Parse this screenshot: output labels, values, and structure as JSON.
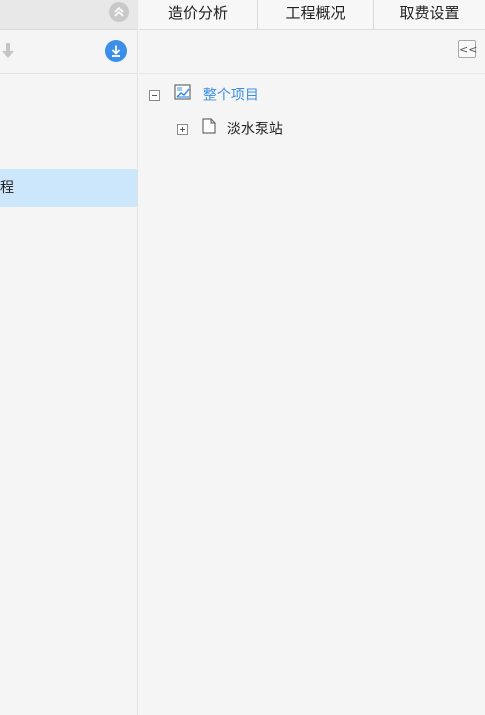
{
  "tabs": [
    {
      "label": "造价分析"
    },
    {
      "label": "工程概况"
    },
    {
      "label": "取费设置"
    }
  ],
  "left_panel": {
    "selected_item_label": "程",
    "icons": {
      "collapse": "double-chevron-up-icon",
      "move_down": "arrow-down-icon",
      "download": "download-circle-icon"
    }
  },
  "right_panel": {
    "collapse_button_label": "<<"
  },
  "tree": {
    "root": {
      "label": "整个项目",
      "expanded": true,
      "icon": "project-icon"
    },
    "children": [
      {
        "label": "淡水泵站",
        "expanded": false,
        "icon": "document-icon"
      }
    ]
  },
  "colors": {
    "accent": "#3a8ee6",
    "selected_row": "#cce6fb",
    "background": "#f5f5f5"
  }
}
